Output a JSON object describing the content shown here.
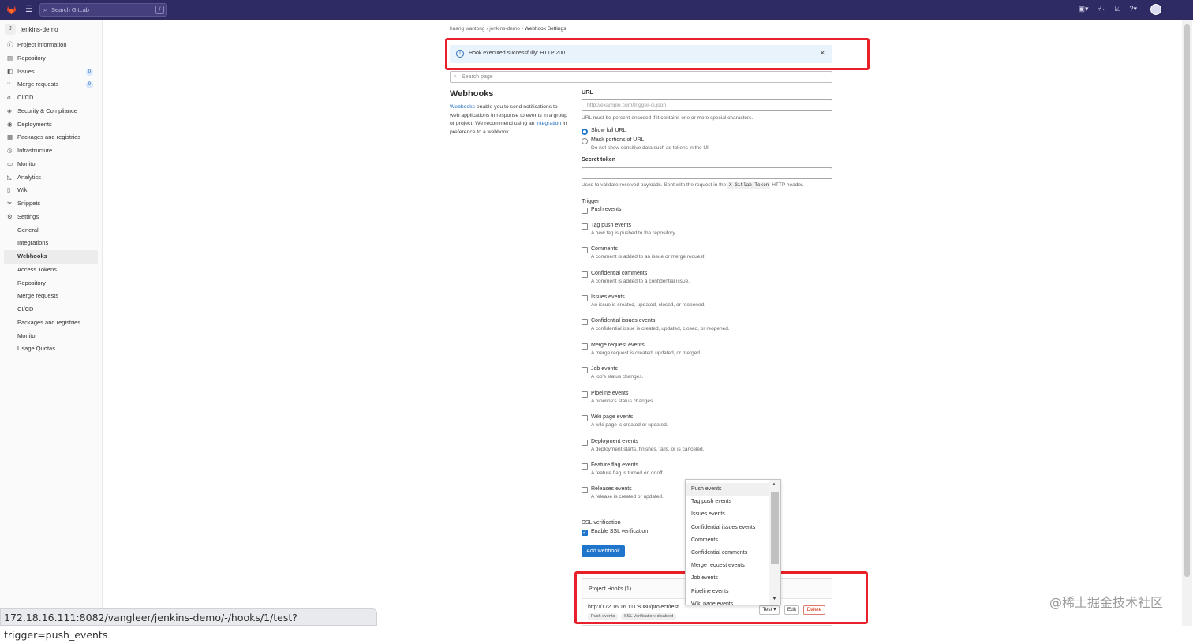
{
  "topbar": {
    "search_placeholder": "Search GitLab",
    "search_shortcut": "/",
    "icons": [
      "issues-icon",
      "merge-requests-icon",
      "todos-icon",
      "help-icon"
    ]
  },
  "sidebar": {
    "project_initial": "J",
    "project_name": "jenkins-demo",
    "items": [
      {
        "label": "Project information",
        "icon": "info-icon"
      },
      {
        "label": "Repository",
        "icon": "doc-icon"
      },
      {
        "label": "Issues",
        "icon": "issues-icon",
        "count": "0"
      },
      {
        "label": "Merge requests",
        "icon": "merge-icon",
        "count": "0"
      },
      {
        "label": "CI/CD",
        "icon": "rocket-icon"
      },
      {
        "label": "Security & Compliance",
        "icon": "shield-icon"
      },
      {
        "label": "Deployments",
        "icon": "deploy-icon"
      },
      {
        "label": "Packages and registries",
        "icon": "package-icon"
      },
      {
        "label": "Infrastructure",
        "icon": "cloud-icon"
      },
      {
        "label": "Monitor",
        "icon": "monitor-icon"
      },
      {
        "label": "Analytics",
        "icon": "chart-icon"
      },
      {
        "label": "Wiki",
        "icon": "book-icon"
      },
      {
        "label": "Snippets",
        "icon": "scissors-icon"
      },
      {
        "label": "Settings",
        "icon": "gear-icon"
      }
    ],
    "settings_sub": [
      "General",
      "Integrations",
      "Webhooks",
      "Access Tokens",
      "Repository",
      "Merge requests",
      "CI/CD",
      "Packages and registries",
      "Monitor",
      "Usage Quotas"
    ]
  },
  "breadcrumb": [
    "huang wantong",
    "jenkins-demo",
    "Webhook Settings"
  ],
  "alert": {
    "text": "Hook executed successfully: HTTP 200"
  },
  "search_page_placeholder": "Search page",
  "left": {
    "title": "Webhooks",
    "desc_link1": "Webhooks",
    "desc_part1": " enable you to send notifications to web applications in response to events in a group or project. We recommend using an ",
    "desc_link2": "integration",
    "desc_part2": " in preference to a webhook."
  },
  "form": {
    "url_label": "URL",
    "url_placeholder": "http://example.com/trigger-ci.json",
    "url_help": "URL must be percent-encoded if it contains one or more special characters.",
    "radio_show": "Show full URL",
    "radio_mask": "Mask portions of URL",
    "radio_mask_desc": "Do not show sensitive data such as tokens in the UI.",
    "secret_label": "Secret token",
    "secret_help_pre": "Used to validate received payloads. Sent with the request in the ",
    "secret_help_code": "X-Gitlab-Token",
    "secret_help_post": " HTTP header.",
    "trigger_label": "Trigger",
    "triggers": [
      {
        "label": "Push events",
        "desc": ""
      },
      {
        "label": "Tag push events",
        "desc": "A new tag is pushed to the repository."
      },
      {
        "label": "Comments",
        "desc": "A comment is added to an issue or merge request."
      },
      {
        "label": "Confidential comments",
        "desc": "A comment is added to a confidential issue."
      },
      {
        "label": "Issues events",
        "desc": "An issue is created, updated, closed, or reopened."
      },
      {
        "label": "Confidential issues events",
        "desc": "A confidential issue is created, updated, closed, or reopened."
      },
      {
        "label": "Merge request events",
        "desc": "A merge request is created, updated, or merged."
      },
      {
        "label": "Job events",
        "desc": "A job's status changes."
      },
      {
        "label": "Pipeline events",
        "desc": "A pipeline's status changes."
      },
      {
        "label": "Wiki page events",
        "desc": "A wiki page is created or updated."
      },
      {
        "label": "Deployment events",
        "desc": "A deployment starts, finishes, fails, or is canceled."
      },
      {
        "label": "Feature flag events",
        "desc": "A feature flag is turned on or off."
      },
      {
        "label": "Releases events",
        "desc": "A release is created or updated."
      }
    ],
    "ssl_label": "SSL verification",
    "ssl_checkbox": "Enable SSL verification",
    "add_button": "Add webhook"
  },
  "hooks": {
    "header": "Project Hooks (1)",
    "url": "http://172.16.16.111:8080/project/test",
    "tags": [
      "Push events",
      "SSL Verification: disabled"
    ],
    "test_button": "Test",
    "edit_button": "Edit",
    "delete_button": "Delete"
  },
  "dropdown": {
    "items": [
      "Push events",
      "Tag push events",
      "Issues events",
      "Confidential issues events",
      "Comments",
      "Confidential comments",
      "Merge request events",
      "Job events",
      "Pipeline events",
      "Wiki page events"
    ]
  },
  "statusbar": "172.18.16.111:8082/vangleer/jenkins-demo/-/hooks/1/test?trigger=push_events",
  "watermark": "@稀土掘金技术社区",
  "colors": {
    "topbar": "#2e2a63",
    "primary": "#1f75cb",
    "highlight_box": "#e8202a",
    "delete": "#dd2b0e"
  }
}
